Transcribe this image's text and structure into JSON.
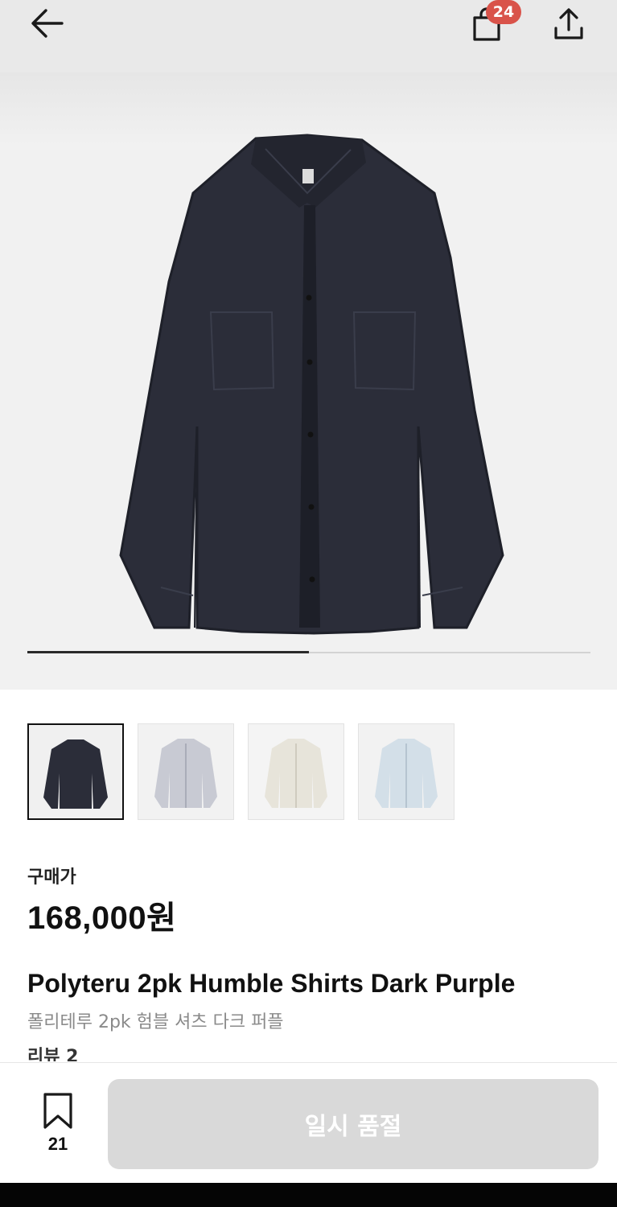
{
  "header": {
    "back_icon": "arrow-left-icon",
    "cart_icon": "shopping-bag-icon",
    "cart_count": "24",
    "share_icon": "share-upload-icon",
    "badge_color": "#d9534a"
  },
  "gallery": {
    "image": "dark-navy-long-sleeve-shirt",
    "progress": 0.5
  },
  "thumbnails": [
    {
      "color": "dark-navy",
      "selected": true
    },
    {
      "color": "gray-stripe",
      "selected": false
    },
    {
      "color": "off-white",
      "selected": false
    },
    {
      "color": "light-blue",
      "selected": false
    }
  ],
  "product": {
    "price_label": "구매가",
    "price": "168,000원",
    "name": "Polyteru 2pk Humble Shirts Dark Purple",
    "name_ko": "폴리테루 2pk 험블 셔츠 다크 퍼플",
    "reviews": "리뷰 2"
  },
  "bottom_bar": {
    "wish_icon": "bookmark-icon",
    "wish_count": "21",
    "action_label": "일시 품절",
    "action_color": "#d9d9d9"
  }
}
